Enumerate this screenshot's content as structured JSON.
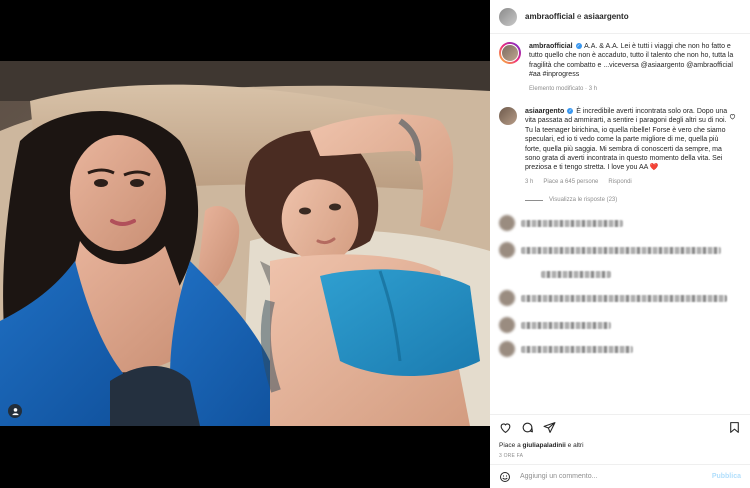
{
  "header": {
    "username": "ambraofficial",
    "connector": " e ",
    "coauthor": "asiaargento"
  },
  "caption": {
    "username": "ambraofficial",
    "text": "A.A. & A.A. Lei è tutti i viaggi che non ho fatto e tutto quello che non è accaduto, tutto il talento che non ho, tutta la fragilità che combatto e ...viceversa @asiaargento @ambraofficial #aa #inprogress",
    "edited": "Elemento modificato · 3 h"
  },
  "reply": {
    "username": "asiaargento",
    "text": "È incredibile averti incontrata solo ora. Dopo una vita passata ad ammirarti, a sentire i paragoni degli altri su di noi. Tu la teenager birichina, io quella ribelle! Forse è vero che siamo speculari, ed io ti vedo come la parte migliore di me, quella più forte, quella più saggia. Mi sembra di conoscerti da sempre, ma sono grata di averti incontrata in questo momento della vita. Sei preziosa e ti tengo stretta. I love you AA",
    "heart_emoji": "❤️",
    "time": "3 h",
    "likes": "Piace a 645 persone",
    "reply_label": "Rispondi",
    "view_replies": "Visualizza le risposte (23)"
  },
  "likes": {
    "prefix": "Piace a ",
    "user": "giuliapaladinii",
    "suffix": " e altri"
  },
  "date": "3 ORE FA",
  "compose": {
    "placeholder": "Aggiungi un commento...",
    "publish": "Pubblica"
  },
  "icons": {
    "heart": "heart-icon",
    "comment": "comment-icon",
    "share": "share-icon",
    "save": "bookmark-icon",
    "emoji": "emoji-icon",
    "tag": "person-tag-icon"
  },
  "colors": {
    "verified": "#3897f0",
    "publish": "#b2dffc",
    "muted": "#8e8e8e"
  }
}
